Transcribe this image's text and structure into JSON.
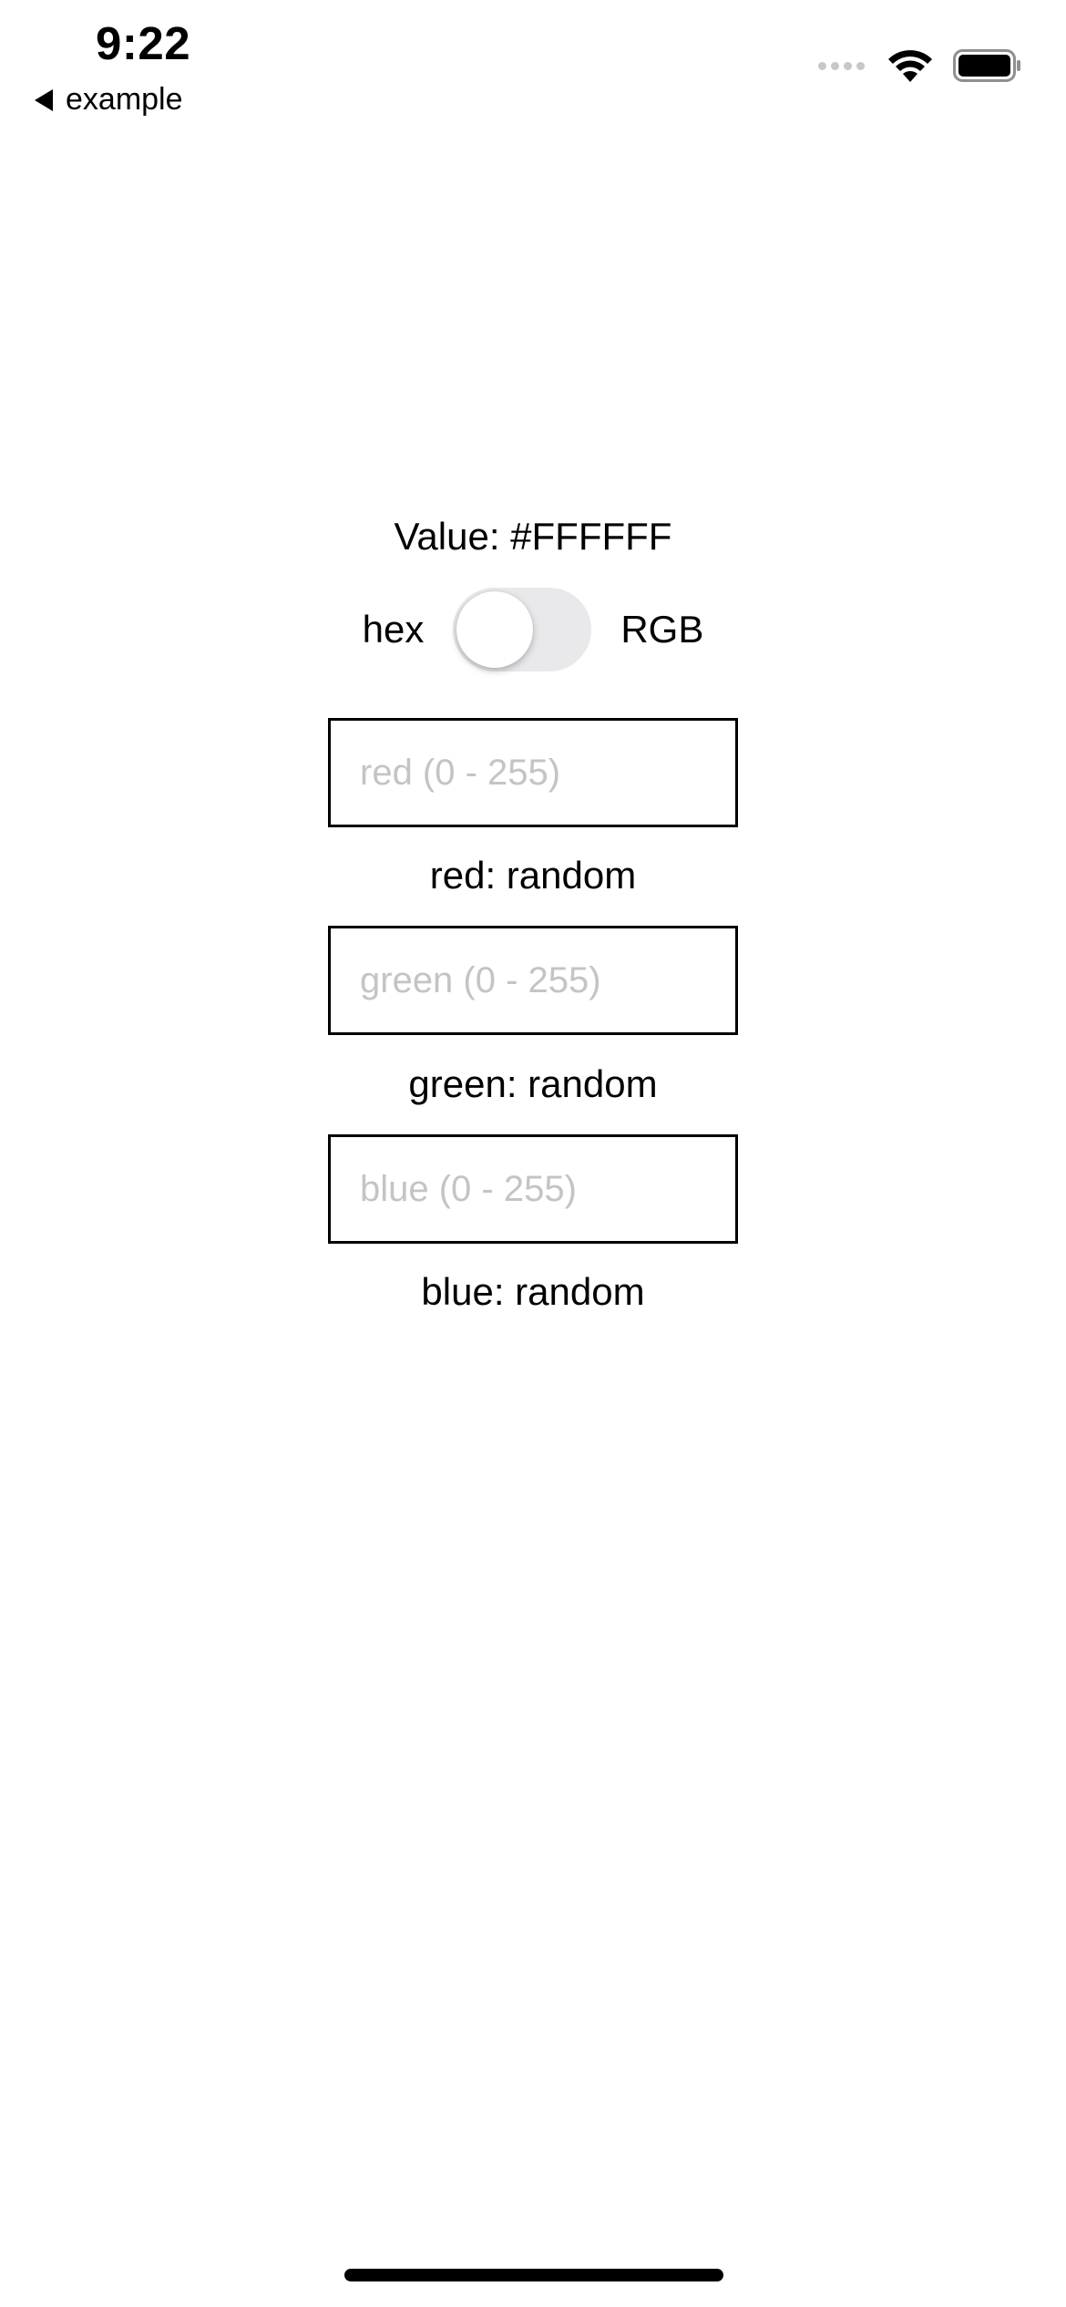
{
  "status_bar": {
    "time": "9:22",
    "back_label": "example"
  },
  "value_label": "Value: #FFFFFF",
  "toggle": {
    "left_label": "hex",
    "right_label": "RGB",
    "on": false
  },
  "channels": {
    "red": {
      "placeholder": "red (0 - 255)",
      "value": "",
      "label": "red: random"
    },
    "green": {
      "placeholder": "green (0 - 255)",
      "value": "",
      "label": "green: random"
    },
    "blue": {
      "placeholder": "blue (0 - 255)",
      "value": "",
      "label": "blue: random"
    }
  },
  "colors": {
    "toggle_track": "#e9e9eb",
    "placeholder": "#c4c4c6",
    "border": "#000000"
  }
}
